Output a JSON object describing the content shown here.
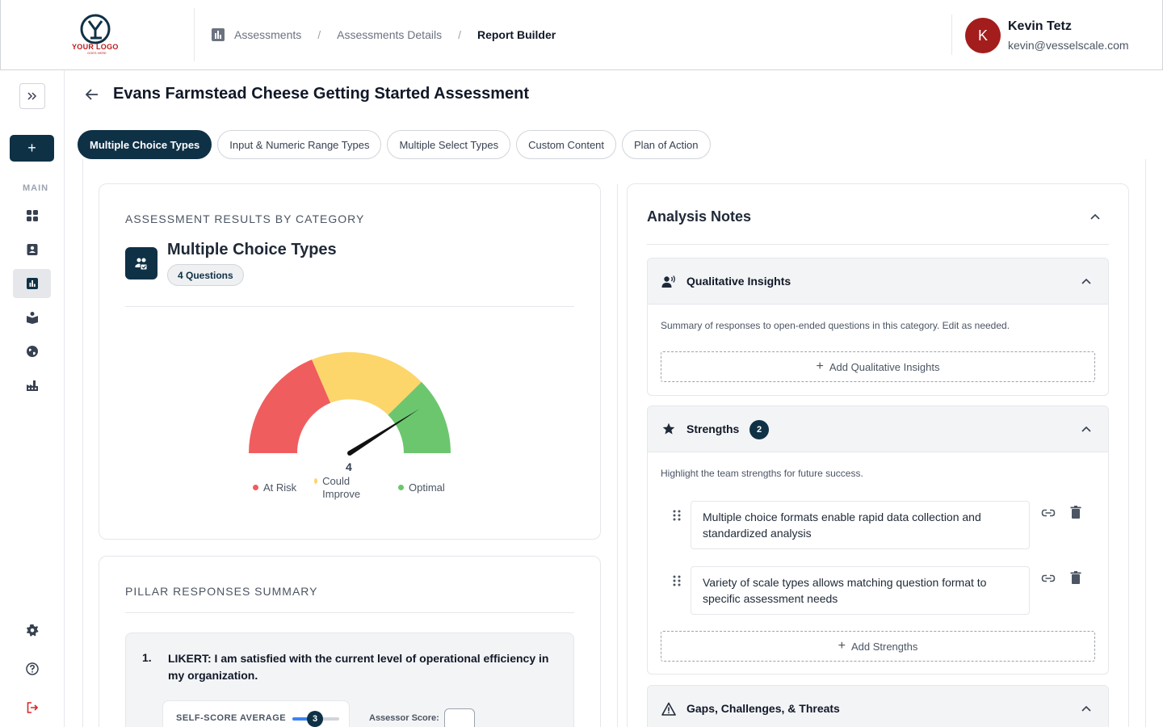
{
  "header": {
    "logo_text": "YOUR LOGO",
    "logo_sub": "GOES HERE",
    "breadcrumbs": [
      "Assessments",
      "Assessments Details",
      "Report Builder"
    ],
    "breadcrumb_sep": "/",
    "user": {
      "initial": "K",
      "name": "Kevin Tetz",
      "email": "kevin@vesselscale.com"
    }
  },
  "sidebar": {
    "add_label": "+",
    "section_label": "MAIN",
    "items": [
      "dashboard-icon",
      "contacts-icon",
      "assessments-icon",
      "library-icon",
      "globe-icon",
      "factory-icon"
    ],
    "bottom": [
      "settings-icon",
      "help-icon",
      "logout-icon"
    ]
  },
  "page": {
    "title": "Evans Farmstead Cheese Getting Started Assessment",
    "tabs": [
      "Multiple Choice Types",
      "Input & Numeric Range Types",
      "Multiple Select Types",
      "Custom Content",
      "Plan of Action"
    ],
    "active_tab": 0
  },
  "results": {
    "section_label": "ASSESSMENT RESULTS BY CATEGORY",
    "category_title": "Multiple Choice Types",
    "question_badge": "4 Questions",
    "gauge_value": "4",
    "gauge_fraction": 0.82,
    "legend": [
      {
        "label": "At Risk",
        "color": "#f05d5e"
      },
      {
        "label": "Could Improve",
        "color": "#fcd66b"
      },
      {
        "label": "Optimal",
        "color": "#6cc66e"
      }
    ]
  },
  "pillar": {
    "section_label": "PILLAR RESPONSES SUMMARY",
    "number": "1.",
    "question": "LIKERT: I am satisfied with the current level of operational efficiency in my organization.",
    "self_score_label": "SELF-SCORE AVERAGE",
    "self_score_value": "3",
    "self_score_fraction": 0.5,
    "assessor_label": "Assessor Score:"
  },
  "notes": {
    "title": "Analysis Notes",
    "qualitative": {
      "title": "Qualitative Insights",
      "description": "Summary of responses to open-ended questions in this category. Edit as needed.",
      "add_label": "Add Qualitative Insights"
    },
    "strengths": {
      "title": "Strengths",
      "count": "2",
      "description": "Highlight the team strengths for future success.",
      "items": [
        "Multiple choice formats enable rapid data collection and standardized analysis",
        "Variety of scale types allows matching question format to specific assessment needs"
      ],
      "add_label": "Add Strengths"
    },
    "gaps": {
      "title": "Gaps, Challenges, & Threats"
    }
  },
  "colors": {
    "brand": "#0f3146",
    "avatar": "#a31d1d",
    "at_risk": "#f05d5e",
    "could_improve": "#fcd66b",
    "optimal": "#6cc66e"
  }
}
